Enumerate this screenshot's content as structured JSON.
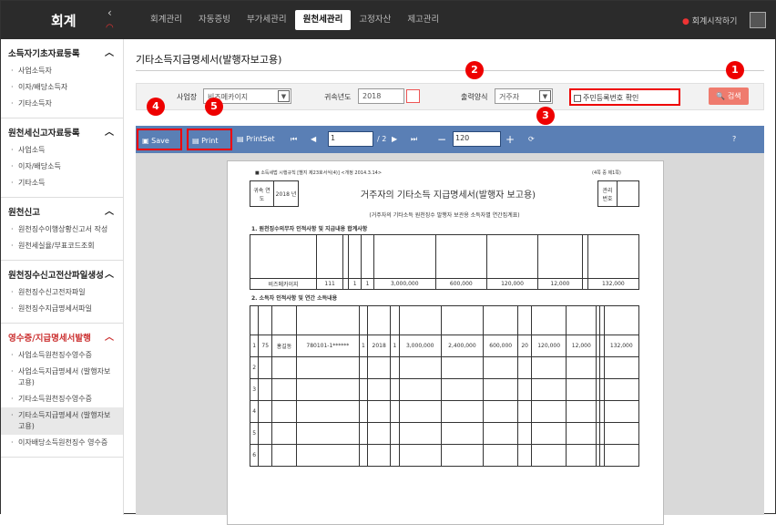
{
  "topbar": {
    "app_title": "회계",
    "collapse_icon": "chevron-left-icon",
    "nav": [
      "회계관리",
      "자동증빙",
      "부가세관리",
      "원천세관리",
      "고정자산",
      "제고관리"
    ],
    "active_nav": "원천세관리",
    "start_label": "회계시작하기"
  },
  "sidebar": [
    {
      "title": "소득자기초자료등록",
      "items": [
        "사업소득자",
        "이자/배당소득자",
        "기타소득자"
      ]
    },
    {
      "title": "원천세신고자료등록",
      "items": [
        "사업소득",
        "이자/배당소득",
        "기타소득"
      ]
    },
    {
      "title": "원천신고",
      "items": [
        "원천징수이행상황신고서 작성",
        "원천세실율/부표코드조회"
      ]
    },
    {
      "title": "원천징수신고전산파일생성",
      "items": [
        "원천징수신고전자파일",
        "원천징수지급명세서파일"
      ]
    },
    {
      "title": "영수증/지급명세서발행",
      "items": [
        "사업소득원천징수영수증",
        "사업소득지급명세서 (발행자보고용)",
        "기타소득원천징수영수증",
        "기타소득지급명세서 (발행자보고용)",
        "이자배당소득원천징수 영수증"
      ]
    }
  ],
  "page": {
    "title": "기타소득지급명세서(발행자보고용)"
  },
  "filter": {
    "business_label": "사업장",
    "business_value": "비즈메카이지",
    "year_label": "귀속년도",
    "year_value": "2018",
    "output_label": "출력양식",
    "output_value": "거주자",
    "resident_check": "주민등록번호 확인",
    "search_label": "검색"
  },
  "markers": [
    "1",
    "2",
    "3",
    "4",
    "5"
  ],
  "viewer": {
    "save": "Save",
    "print": "Print",
    "printset": "PrintSet",
    "page": "1",
    "total": "/ 2",
    "zoom": "120"
  },
  "doc": {
    "header_note": "■ 소득세법 시행규칙 [별지 제23호서식(4)] <개정 2014.3.14>",
    "page_note": "(4쪽 중 제1쪽)",
    "year_label": "귀속 연도",
    "year": "2018 년",
    "title": "거주자의 기타소득 지급명세서(발행자 보고용)",
    "subtitle": "(거주자의 기타소득 원천징수 발행자 보관용 소득자별 연간집계표)",
    "mgmt": "관리 번호",
    "sec1": "1. 원천징수의무자 인적사항 및 지급내용 합계사항",
    "sec2": "2. 소득자 인적사항 및 연간 소득내용",
    "company": "비즈메카이지",
    "code": "111",
    "one": "1",
    "amt1": "3,000,000",
    "amt2": "600,000",
    "tax1": "120,000",
    "tax2": "12,000",
    "tax3": "132,000",
    "name": "홍길동",
    "rrn": "780101-1******",
    "yr": "2018",
    "amt3": "2,400,000",
    "rate": "20",
    "rows": [
      "1",
      "2",
      "3",
      "4",
      "5",
      "6"
    ]
  }
}
